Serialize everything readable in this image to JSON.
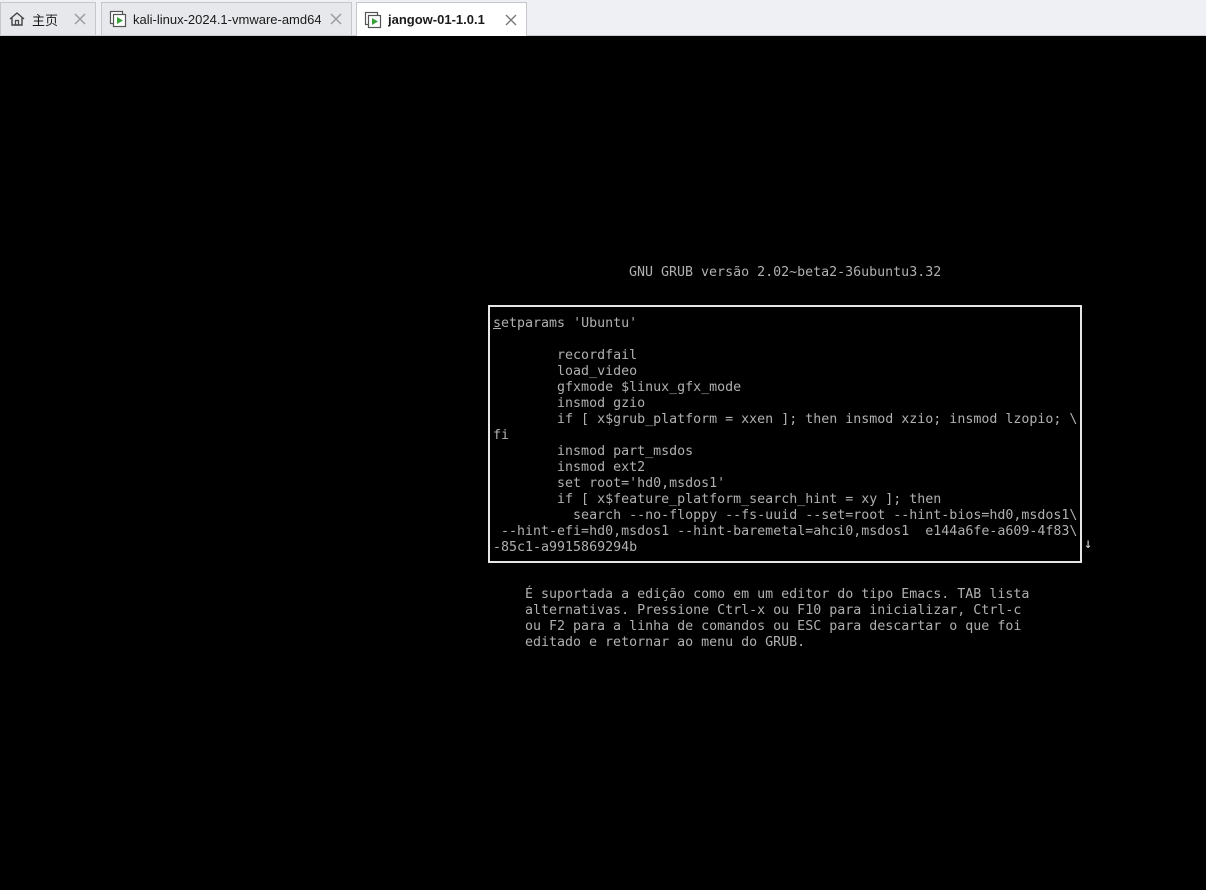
{
  "tabs": [
    {
      "label": "主页",
      "icon": "home-icon",
      "active": false
    },
    {
      "label": "kali-linux-2024.1-vmware-amd64",
      "icon": "vm-play-icon",
      "active": false
    },
    {
      "label": "jangow-01-1.0.1",
      "icon": "vm-play-icon",
      "active": true
    }
  ],
  "console": {
    "header": "GNU GRUB versão 2.02~beta2-36ubuntu3.32",
    "editor_first_char": "s",
    "editor_first_rest": "etparams 'Ubuntu'",
    "editor_lines": [
      "",
      "        recordfail",
      "        load_video",
      "        gfxmode $linux_gfx_mode",
      "        insmod gzio",
      "        if [ x$grub_platform = xxen ]; then insmod xzio; insmod lzopio; \\",
      "fi",
      "        insmod part_msdos",
      "        insmod ext2",
      "        set root='hd0,msdos1'",
      "        if [ x$feature_platform_search_hint = xy ]; then",
      "          search --no-floppy --fs-uuid --set=root --hint-bios=hd0,msdos1\\",
      " --hint-efi=hd0,msdos1 --hint-baremetal=ahci0,msdos1  e144a6fe-a609-4f83\\",
      "-85c1-a9915869294b"
    ],
    "scroll_arrow": "↓",
    "help_lines": [
      "É suportada a edição como em um editor do tipo Emacs. TAB lista",
      "alternativas. Pressione Ctrl-x ou F10 para inicializar, Ctrl-c",
      "ou F2 para a linha de comandos ou ESC para descartar o que foi",
      "editado e retornar ao menu do GRUB."
    ]
  },
  "colors": {
    "console_background": "#000000",
    "console_text": "#b0b0b0",
    "editor_border": "#e6e6e6",
    "tabbar_background": "#eef0f3",
    "active_tab_background": "#ffffff",
    "vm_icon_green": "#3aa03a"
  }
}
